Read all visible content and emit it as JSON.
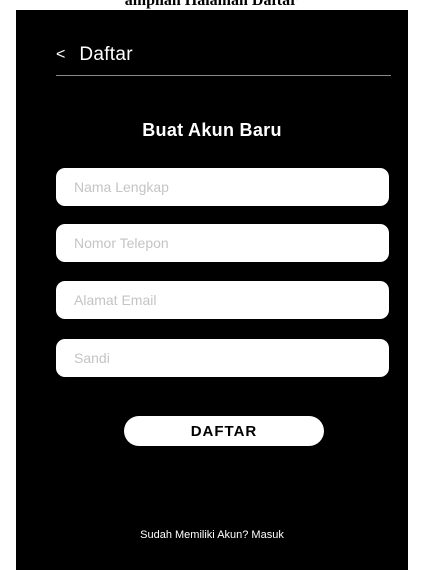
{
  "caption": "ampilan Halaman Daftar",
  "header": {
    "back_icon": "<",
    "title": "Daftar"
  },
  "form": {
    "title": "Buat Akun Baru",
    "full_name_placeholder": "Nama Lengkap",
    "phone_placeholder": "Nomor Telepon",
    "email_placeholder": "Alamat Email",
    "password_placeholder": "Sandi",
    "submit_label": "DAFTAR"
  },
  "footer": {
    "login_link": "Sudah Memiliki Akun? Masuk"
  },
  "colors": {
    "background": "#000000",
    "field": "#ffffff",
    "button": "#ffffff"
  }
}
